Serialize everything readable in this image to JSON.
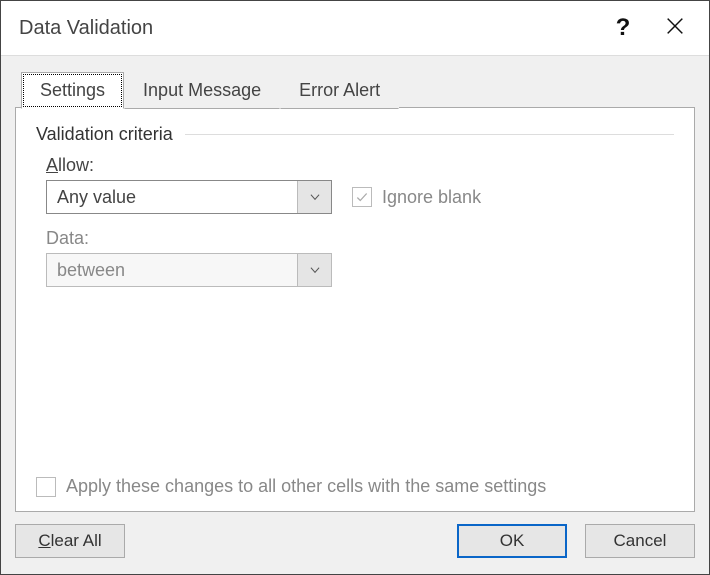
{
  "title": "Data Validation",
  "tabs": {
    "settings": "Settings",
    "input_message": "Input Message",
    "error_alert": "Error Alert"
  },
  "section_title": "Validation criteria",
  "allow": {
    "label_prefix": "A",
    "label_rest": "llow:",
    "value": "Any value"
  },
  "data": {
    "label": "Data:",
    "value": "between"
  },
  "ignore_blank": {
    "label": "Ignore blank",
    "checked": true
  },
  "apply_all": {
    "label": "Apply these changes to all other cells with the same settings",
    "checked": false
  },
  "buttons": {
    "clear_prefix": "C",
    "clear_rest": "lear All",
    "ok": "OK",
    "cancel": "Cancel"
  }
}
